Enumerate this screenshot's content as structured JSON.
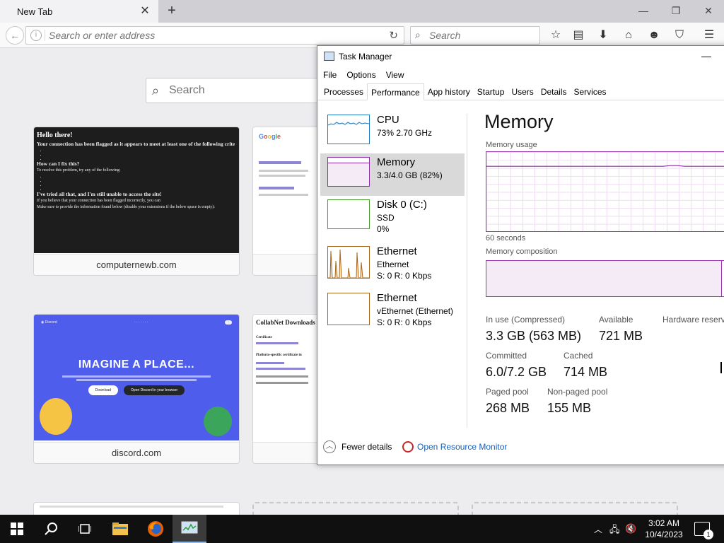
{
  "browser": {
    "tab_title": "New Tab",
    "url_placeholder": "Search or enter address",
    "search_placeholder": "Search"
  },
  "newtab": {
    "search_placeholder": "Search",
    "tiles": [
      {
        "label": "computernewb.com"
      },
      {
        "label": ""
      },
      {
        "label": "discord.com"
      },
      {
        "label": ""
      }
    ],
    "computernewb_thumb": {
      "heading": "Hello there!",
      "flagged": "Your connection has been flagged as it appears to meet at least one of the following crite",
      "fix_q": "How can I fix this?",
      "fix_line": "To resolve this problem, try any of the following:",
      "tried": "I've tried all that, and I'm still unable to access the site!",
      "believe": "If you believe that your connection has been flagged incorrectly, you can",
      "info": "Make sure to provide the information found below (disable your extensions if the below space is empty):"
    },
    "discord_thumb": {
      "headline": "IMAGINE A PLACE...",
      "download": "Download",
      "open": "Open Discord in your browser"
    },
    "collab_thumb": {
      "title": "CollabNet Downloads",
      "certificate": "Certificate",
      "platform": "Platform-specific certificate in"
    }
  },
  "taskmanager": {
    "title": "Task Manager",
    "menu": [
      "File",
      "Options",
      "View"
    ],
    "tabs": [
      "Processes",
      "Performance",
      "App history",
      "Startup",
      "Users",
      "Details",
      "Services"
    ],
    "active_tab": "Performance",
    "resources": [
      {
        "name": "CPU",
        "line1": "73%  2.70 GHz",
        "line2": "",
        "color": "#1f7bbf"
      },
      {
        "name": "Memory",
        "line1": "3.3/4.0 GB (82%)",
        "line2": "",
        "color": "#8b2fa8"
      },
      {
        "name": "Disk 0 (C:)",
        "line1": "SSD",
        "line2": "0%",
        "color": "#4aa02c"
      },
      {
        "name": "Ethernet",
        "line1": "Ethernet",
        "line2": "S: 0  R: 0 Kbps",
        "color": "#a7661a"
      },
      {
        "name": "Ethernet",
        "line1": "vEthernet (Ethernet)",
        "line2": "S: 0  R: 0 Kbps",
        "color": "#a7661a"
      }
    ],
    "memory": {
      "title": "Memory",
      "usage_label": "Memory usage",
      "seconds_label": "60 seconds",
      "composition_label": "Memory composition",
      "usage_percent": 82,
      "stats": {
        "in_use_label": "In use (Compressed)",
        "in_use_value": "3.3 GB (563 MB)",
        "available_label": "Available",
        "available_value": "721 MB",
        "hw_reserved_label": "Hardware reserve",
        "committed_label": "Committed",
        "committed_value": "6.0/7.2 GB",
        "cached_label": "Cached",
        "cached_value": "714 MB",
        "paged_label": "Paged pool",
        "paged_value": "268 MB",
        "nonpaged_label": "Non-paged pool",
        "nonpaged_value": "155 MB"
      }
    },
    "footer": {
      "fewer_details": "Fewer details",
      "resource_monitor": "Open Resource Monitor"
    }
  },
  "taskbar": {
    "time": "3:02 AM",
    "date": "10/4/2023",
    "notification_count": "1"
  }
}
